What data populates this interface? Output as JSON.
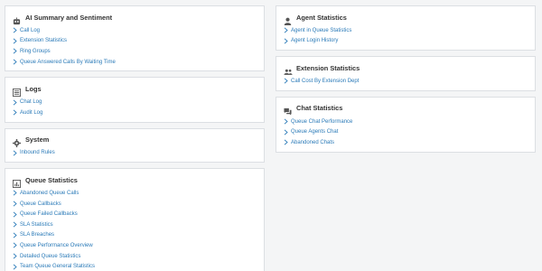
{
  "colors": {
    "link": "#2a7ab8",
    "title": "#333333",
    "icon": "#555555"
  },
  "left_cards": [
    {
      "key": "ai-summary",
      "icon": "robot-icon",
      "title": "AI Summary and Sentiment",
      "links": [
        "Call Log",
        "Extension Statistics",
        "Ring Groups",
        "Queue Answered Calls By Waiting Time"
      ]
    },
    {
      "key": "logs",
      "icon": "log-list-icon",
      "title": "Logs",
      "links": [
        "Chat Log",
        "Audit Log"
      ]
    },
    {
      "key": "system",
      "icon": "gear-icon",
      "title": "System",
      "links": [
        "Inbound Rules"
      ]
    },
    {
      "key": "queue-statistics",
      "icon": "queue-chart-icon",
      "title": "Queue Statistics",
      "links": [
        "Abandoned Queue Calls",
        "Queue Callbacks",
        "Queue Failed Callbacks",
        "SLA Statistics",
        "SLA Breaches",
        "Queue Performance Overview",
        "Detailed Queue Statistics",
        "Team Queue General Statistics"
      ]
    }
  ],
  "right_cards": [
    {
      "key": "agent-statistics",
      "icon": "agent-icon",
      "title": "Agent Statistics",
      "links": [
        "Agent in Queue Statistics",
        "Agent Login History"
      ]
    },
    {
      "key": "extension-statistics",
      "icon": "users-icon",
      "title": "Extension Statistics",
      "links": [
        "Call Cost By Extension Dept"
      ]
    },
    {
      "key": "chat-statistics",
      "icon": "chat-icon",
      "title": "Chat Statistics",
      "links": [
        "Queue Chat Performance",
        "Queue Agents Chat",
        "Abandoned Chats"
      ]
    }
  ]
}
